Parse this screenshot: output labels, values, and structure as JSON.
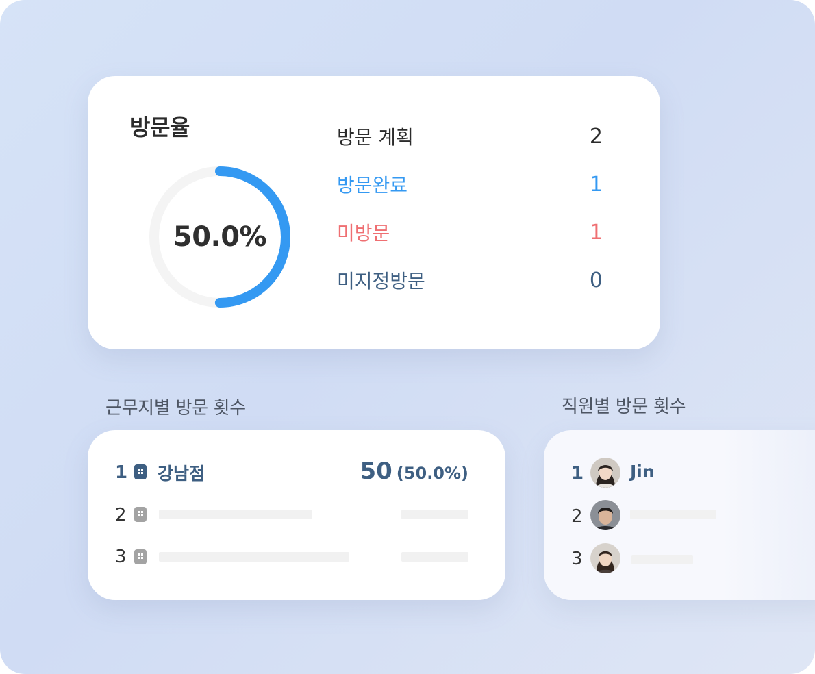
{
  "visit_rate": {
    "title": "방문율",
    "rate_text": "50.0%",
    "rate_fraction": 0.5,
    "colors": {
      "progress": "#3499f2",
      "track": "#f4f4f4"
    },
    "stats": [
      {
        "label": "방문 계획",
        "value": "2",
        "color": "#2b2b2b"
      },
      {
        "label": "방문완료",
        "value": "1",
        "color": "#3499f2"
      },
      {
        "label": "미방문",
        "value": "1",
        "color": "#ef6f72"
      },
      {
        "label": "미지정방문",
        "value": "0",
        "color": "#3e5f82"
      }
    ]
  },
  "location_section": {
    "heading": "근무지별 방문 횟수",
    "rows": [
      {
        "rank": "1",
        "icon": "building-icon",
        "name": "강남점",
        "count": "50",
        "percent": "(50.0%)"
      },
      {
        "rank": "2",
        "icon": "building-icon"
      },
      {
        "rank": "3",
        "icon": "building-icon"
      }
    ]
  },
  "staff_section": {
    "heading": "직원별 방문 횟수",
    "rows": [
      {
        "rank": "1",
        "avatar": "avatar-photo",
        "name": "Jin"
      },
      {
        "rank": "2",
        "avatar": "avatar-photo"
      },
      {
        "rank": "3",
        "avatar": "avatar-photo"
      }
    ]
  }
}
